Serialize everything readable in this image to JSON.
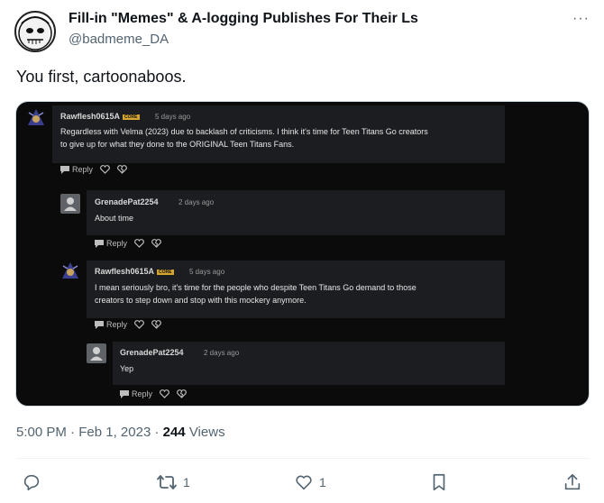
{
  "author": {
    "name": "Fill-in \"Memes\" & A-logging Publishes For Their Ls",
    "handle": "@badmeme_DA",
    "more_icon": "more-horizontal-icon"
  },
  "tweet": {
    "text": "You first, cartoonaboos."
  },
  "screenshot": {
    "comments": [
      {
        "user": "Rawflesh0615A",
        "badge": "CORE",
        "time": "5 days ago",
        "lines": [
          "Regardless with Velma (2023) due to backlash of criticisms. I think it's time for Teen Titans Go creators",
          "to give up for what they done to the ORIGINAL Teen Titans Fans."
        ],
        "reply_label": "Reply"
      },
      {
        "user": "GrenadePat2254",
        "time": "2 days ago",
        "lines": [
          "About time"
        ],
        "reply_label": "Reply"
      },
      {
        "user": "Rawflesh0615A",
        "badge": "CORE",
        "time": "5 days ago",
        "lines": [
          "I mean seriously bro, it's time for the people who despite Teen Titans Go demand to those",
          "creators to step down and stop with this mockery anymore."
        ],
        "reply_label": "Reply"
      },
      {
        "user": "GrenadePat2254",
        "time": "2 days ago",
        "lines": [
          "Yep"
        ],
        "reply_label": "Reply"
      }
    ]
  },
  "meta": {
    "time": "5:00 PM",
    "separator": " · ",
    "date": "Feb 1, 2023",
    "views_count": "244",
    "views_label": "Views"
  },
  "actions": {
    "reply_icon": "comment-icon",
    "retweet_icon": "retweet-icon",
    "retweet_count": "1",
    "like_icon": "heart-icon",
    "like_count": "1",
    "bookmark_icon": "bookmark-icon",
    "share_icon": "share-icon"
  },
  "colors": {
    "text_primary": "#0f1419",
    "text_secondary": "#536471",
    "screenshot_bg": "#0b0b0b",
    "comment_box": "#1c1d20",
    "badge": "#d6a530"
  }
}
